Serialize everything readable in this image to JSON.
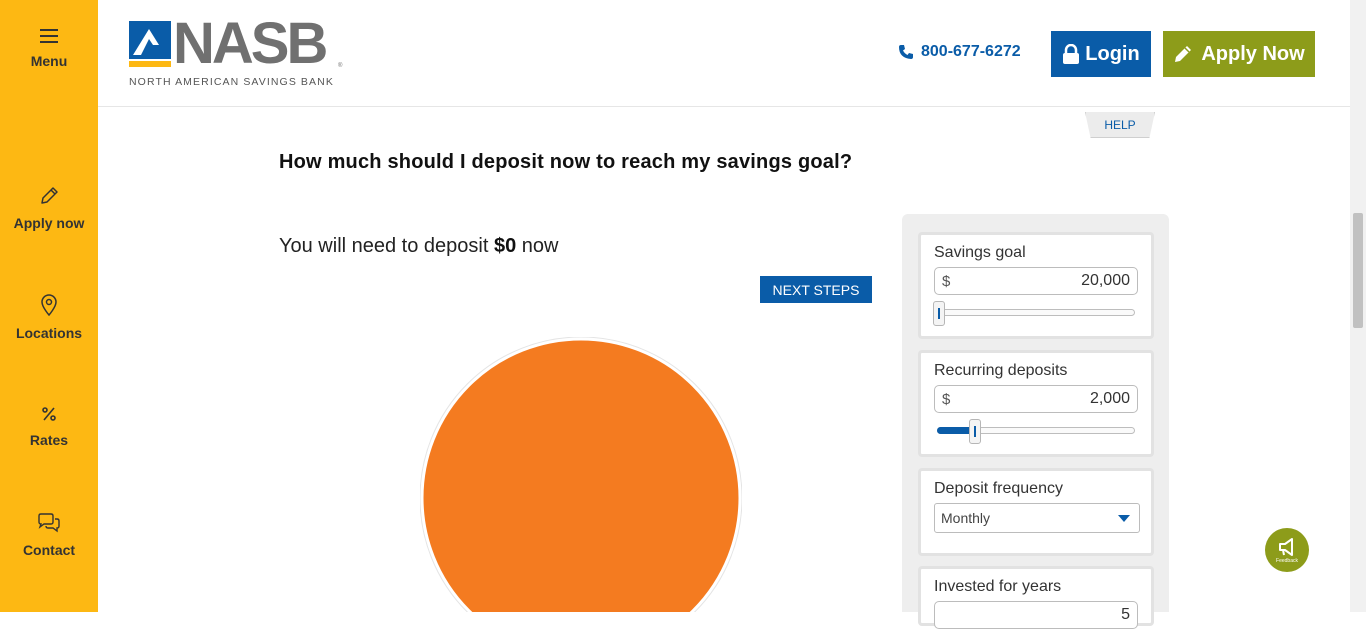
{
  "sidebar": {
    "items": [
      {
        "label": "Menu",
        "icon": "hamburger-icon"
      },
      {
        "label": "Apply now",
        "icon": "pencil-icon"
      },
      {
        "label": "Locations",
        "icon": "map-pin-icon"
      },
      {
        "label": "Rates",
        "icon": "percent-icon"
      },
      {
        "label": "Contact",
        "icon": "chat-bubbles-icon"
      }
    ],
    "background": "#fdb813"
  },
  "header": {
    "logo_text": "NASB",
    "logo_tagline": "NORTH AMERICAN SAVINGS BANK",
    "phone": "800-677-6272",
    "login_label": "Login",
    "apply_label": "Apply Now"
  },
  "main": {
    "help_label": "HELP",
    "title": "How much should I deposit now to reach my savings goal?",
    "result_prefix": "You will need to deposit ",
    "result_amount": "$0",
    "result_suffix": " now",
    "next_steps_label": "NEXT STEPS",
    "chart_color": "#f47b20"
  },
  "form": {
    "savings_goal": {
      "label": "Savings goal",
      "currency": "$",
      "value": "20,000",
      "slider_level": 0.01
    },
    "recurring_deposits": {
      "label": "Recurring deposits",
      "currency": "$",
      "value": "2,000",
      "slider_level": 0.19
    },
    "deposit_frequency": {
      "label": "Deposit frequency",
      "selected": "Monthly"
    },
    "invested_for_years": {
      "label": "Invested for years",
      "value": "5"
    }
  },
  "colors": {
    "brand_blue": "#0a5ca8",
    "brand_green": "#8d9c1a",
    "brand_yellow": "#fdb813",
    "chart_orange": "#f47b20"
  }
}
